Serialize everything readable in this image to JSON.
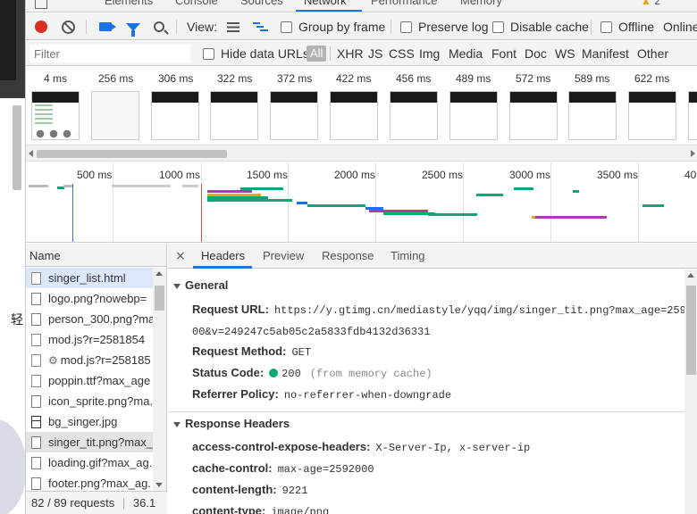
{
  "devtools_tabs": [
    "Elements",
    "Console",
    "Sources",
    "Network",
    "Performance",
    "Memory"
  ],
  "active_tab": "Network",
  "warning_count": "2",
  "page_glyph": "轻",
  "toolbar": {
    "view_label": "View:",
    "group_by_frame": "Group by frame",
    "preserve_log": "Preserve log",
    "disable_cache": "Disable cache",
    "offline": "Offline",
    "online": "Online"
  },
  "filterbar": {
    "filter_placeholder": "Filter",
    "hide_data_urls": "Hide data URLs",
    "types": [
      "All",
      "XHR",
      "JS",
      "CSS",
      "Img",
      "Media",
      "Font",
      "Doc",
      "WS",
      "Manifest",
      "Other"
    ]
  },
  "filmstrip": {
    "frames": [
      "4 ms",
      "256 ms",
      "306 ms",
      "322 ms",
      "372 ms",
      "422 ms",
      "456 ms",
      "489 ms",
      "572 ms",
      "589 ms",
      "622 ms"
    ]
  },
  "overview": {
    "ticks": [
      "500 ms",
      "1000 ms",
      "1500 ms",
      "2000 ms",
      "2500 ms",
      "3000 ms",
      "3500 ms",
      "40"
    ]
  },
  "requests": {
    "header": "Name",
    "items": [
      "singer_list.html",
      "logo.png?nowebp=",
      "person_300.png?ma",
      "mod.js?r=2581854",
      "mod.js?r=258185",
      "poppin.ttf?max_age",
      "icon_sprite.png?ma.",
      "bg_singer.jpg",
      "singer_tit.png?max_",
      "loading.gif?max_ag.",
      "footer.png?max_ag."
    ],
    "status": "82 / 89 requests",
    "status_size": "36.1"
  },
  "detail": {
    "tabs": [
      "Headers",
      "Preview",
      "Response",
      "Timing"
    ],
    "active_tab": "Headers",
    "close": "×",
    "general": {
      "title": "General",
      "request_url_label": "Request URL:",
      "request_url_value": "https://y.gtimg.cn/mediastyle/yqq/img/singer_tit.png?max_age=259",
      "request_url_cont": "00&v=249247c5ab05c2a5833fdb4132d36331",
      "request_method_label": "Request Method:",
      "request_method_value": "GET",
      "status_code_label": "Status Code:",
      "status_code_value": "200",
      "status_code_note": "(from memory cache)",
      "referrer_policy_label": "Referrer Policy:",
      "referrer_policy_value": "no-referrer-when-downgrade"
    },
    "response_headers": {
      "title": "Response Headers",
      "items": [
        {
          "key": "access-control-expose-headers:",
          "value": "X-Server-Ip, x-server-ip"
        },
        {
          "key": "cache-control:",
          "value": "max-age=2592000"
        },
        {
          "key": "content-length:",
          "value": "9221"
        },
        {
          "key": "content-type:",
          "value": "image/png"
        }
      ]
    }
  },
  "colors": {
    "accent": "#1a73e8",
    "record": "#d93025",
    "status_ok": "#0ca678"
  }
}
